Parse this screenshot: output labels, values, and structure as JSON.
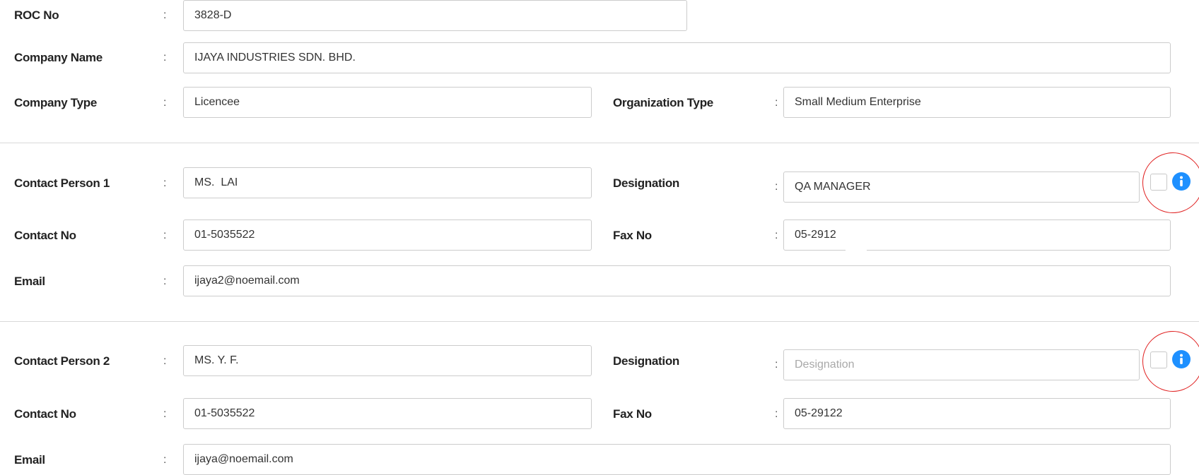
{
  "company": {
    "roc_no": {
      "label": "ROC No",
      "value": "3828-D"
    },
    "company_name": {
      "label": "Company Name",
      "value": "IJAYA INDUSTRIES SDN. BHD."
    },
    "company_type": {
      "label": "Company Type",
      "value": "Licencee"
    },
    "organization_type": {
      "label": "Organization Type",
      "value": "Small Medium Enterprise"
    }
  },
  "contact1": {
    "person": {
      "label": "Contact Person 1",
      "value": "MS.  LAI"
    },
    "designation": {
      "label": "Designation",
      "value": "QA MANAGER",
      "placeholder": "Designation"
    },
    "contact_no": {
      "label": "Contact No",
      "value": "01-5035522"
    },
    "fax_no": {
      "label": "Fax No",
      "value": "05-2912"
    },
    "email": {
      "label": "Email",
      "value": "ijaya2@noemail.com"
    }
  },
  "contact2": {
    "person": {
      "label": "Contact Person 2",
      "value": "MS. Y. F."
    },
    "designation": {
      "label": "Designation",
      "value": "",
      "placeholder": "Designation"
    },
    "contact_no": {
      "label": "Contact No",
      "value": "01-5035522"
    },
    "fax_no": {
      "label": "Fax No",
      "value": "05-29122"
    },
    "email": {
      "label": "Email",
      "value": "ijaya@noemail.com"
    }
  },
  "separator": ":",
  "icons": {
    "info": "info-icon",
    "checkbox": "checkbox"
  },
  "colors": {
    "info_icon": "#1e90ff",
    "highlight_ring": "#e02020",
    "divider": "#d9d9d9",
    "border": "#cccccc"
  }
}
